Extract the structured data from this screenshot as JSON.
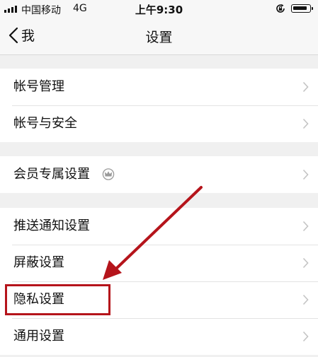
{
  "status_bar": {
    "carrier": "中国移动",
    "network": "4G",
    "time": "上午9:30"
  },
  "nav": {
    "back_label": "我",
    "title": "设置"
  },
  "groups": [
    {
      "items": [
        {
          "label": "帐号管理"
        },
        {
          "label": "帐号与安全"
        }
      ]
    },
    {
      "items": [
        {
          "label": "会员专属设置",
          "icon": "crown-icon"
        }
      ]
    },
    {
      "items": [
        {
          "label": "推送通知设置"
        },
        {
          "label": "屏蔽设置"
        },
        {
          "label": "隐私设置",
          "highlighted": true
        },
        {
          "label": "通用设置"
        }
      ]
    }
  ],
  "annotation": {
    "color": "#b5141b",
    "target": "隐私设置"
  }
}
